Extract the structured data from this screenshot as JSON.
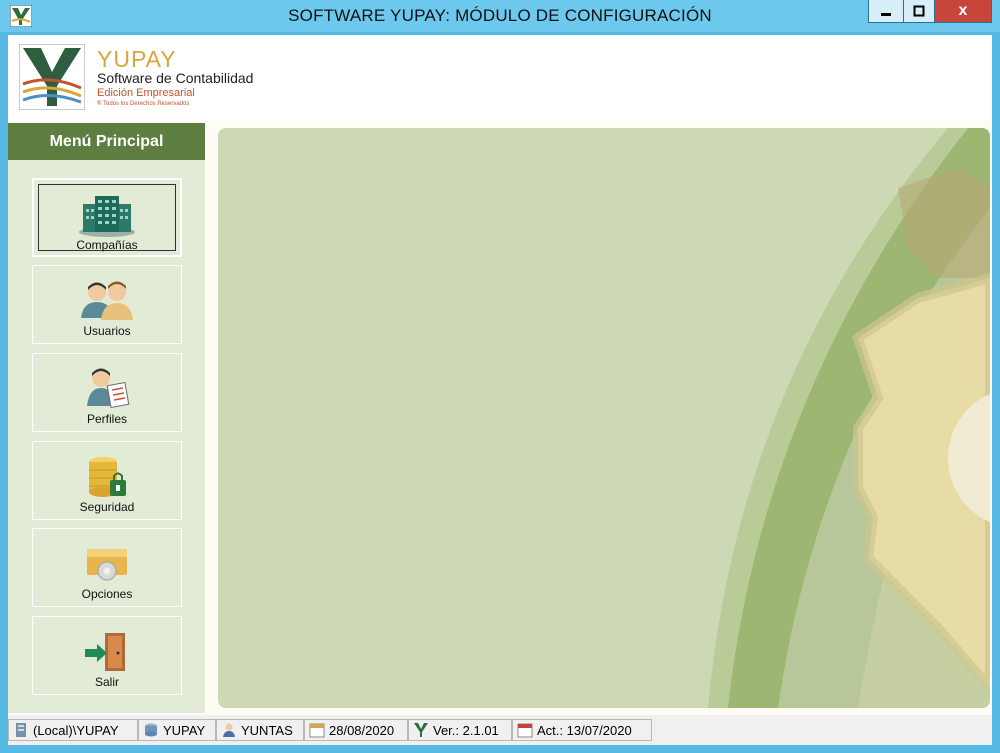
{
  "window": {
    "title": "SOFTWARE YUPAY: MÓDULO DE CONFIGURACIÓN",
    "close_glyph": "x"
  },
  "brand": {
    "name": "YUPAY",
    "subtitle": "Software de Contabilidad",
    "edition": "Edición Empresarial",
    "rights": "® Todos los Derechos Reservados"
  },
  "sidebar": {
    "title": "Menú Principal",
    "items": [
      {
        "label": "Compañías",
        "icon": "companies-icon",
        "active": true
      },
      {
        "label": "Usuarios",
        "icon": "users-icon"
      },
      {
        "label": "Perfiles",
        "icon": "profiles-icon"
      },
      {
        "label": "Seguridad",
        "icon": "security-icon"
      },
      {
        "label": "Opciones",
        "icon": "options-icon"
      },
      {
        "label": "Salir",
        "icon": "exit-icon"
      }
    ]
  },
  "status": {
    "server": "(Local)\\YUPAY",
    "database": "YUPAY",
    "user": "YUNTAS",
    "date": "28/08/2020",
    "version": "Ver.: 2.1.01",
    "updated": "Act.: 13/07/2020"
  },
  "colors": {
    "menu_header": "#5e7d40",
    "sidebar_bg": "#e2ebd6",
    "panel_bg": "#ccd9b4",
    "brand_gold": "#d9a63a",
    "brand_red": "#c3532e",
    "titlebar": "#6cc8ec"
  }
}
